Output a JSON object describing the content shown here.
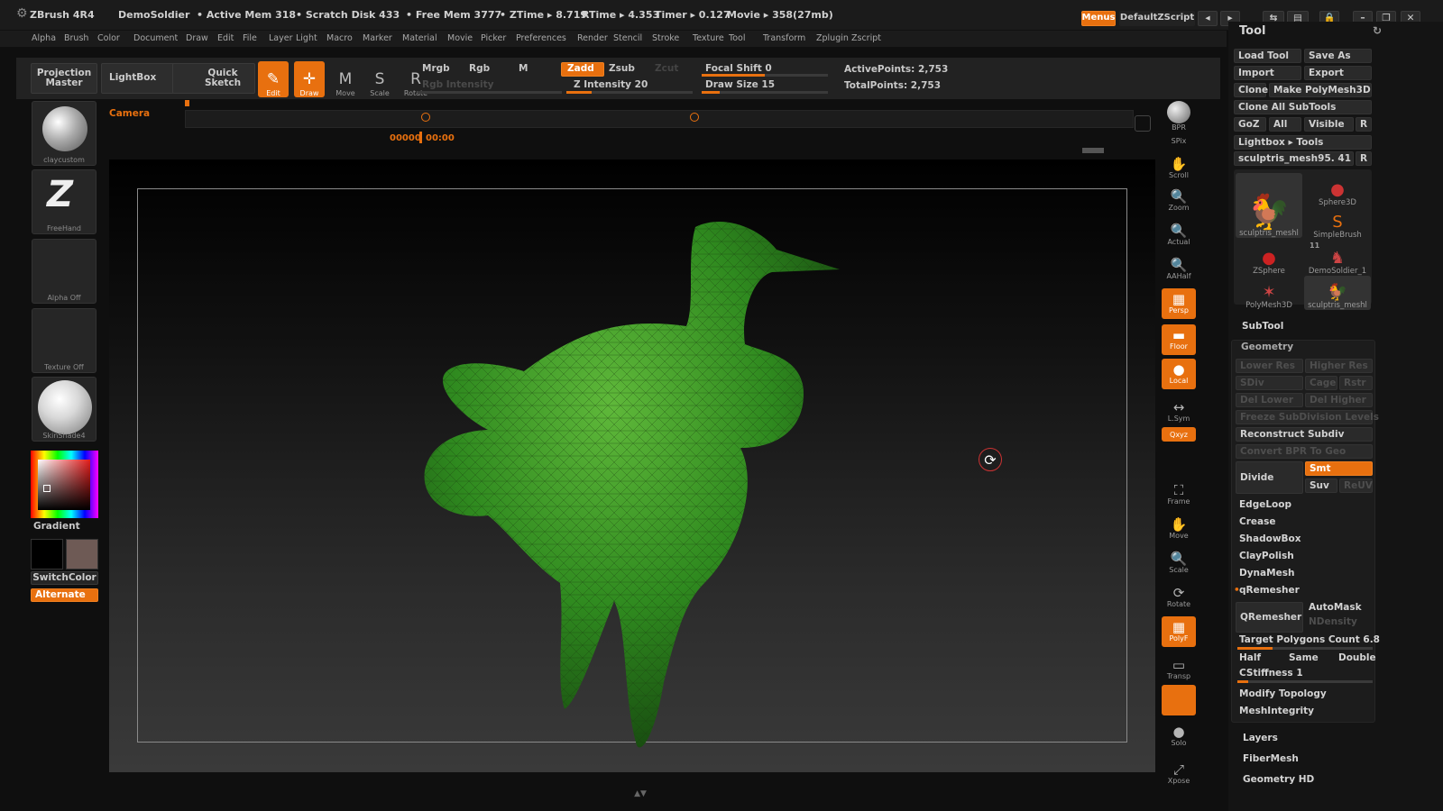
{
  "title": {
    "app": "ZBrush 4R4",
    "document": "DemoSoldier",
    "active_mem": "• Active Mem 318",
    "scratch_disk": "• Scratch Disk 433",
    "free_mem": "• Free Mem 3777",
    "ztime": "• ZTime ▸ 8.719",
    "rtime": "RTime ▸ 4.353",
    "timer": "Timer ▸ 0.127",
    "movie": "Movie ▸ 358(27mb)",
    "menus_btn": "Menus",
    "script_btn": "DefaultZScript"
  },
  "menu": [
    "Alpha",
    "Brush",
    "Color",
    "Document",
    "Draw",
    "Edit",
    "File",
    "Layer",
    "Light",
    "Macro",
    "Marker",
    "Material",
    "Movie",
    "Picker",
    "Preferences",
    "Render",
    "Stencil",
    "Stroke",
    "Texture",
    "Tool",
    "Transform",
    "Zplugin",
    "Zscript"
  ],
  "toolbar": {
    "projection_master": "Projection Master",
    "lightbox": "LightBox",
    "quick_sketch": "Quick Sketch",
    "edit": "Edit",
    "draw": "Draw",
    "move": "Move",
    "scale": "Scale",
    "rotate": "Rotate",
    "mrgb": "Mrgb",
    "rgb": "Rgb",
    "m": "M",
    "rgb_intensity": "Rgb Intensity",
    "zadd": "Zadd",
    "zsub": "Zsub",
    "zcut": "Zcut",
    "z_intensity": "Z Intensity 20",
    "z_intensity_value": 0.2,
    "focal_shift": "Focal Shift 0",
    "focal_shift_value": 0.5,
    "draw_size": "Draw Size 15",
    "draw_size_value": 0.14,
    "active_points": "ActivePoints: 2,753",
    "total_points": "TotalPoints: 2,753"
  },
  "timeline": {
    "track_label": "Camera",
    "time": "00000",
    "time2": "00:00"
  },
  "left": {
    "brush": "claycustom",
    "stroke": "FreeHand",
    "alpha": "Alpha Off",
    "texture": "Texture Off",
    "material": "SkinShade4",
    "gradient": "Gradient",
    "switch_color": "SwitchColor",
    "alternate": "Alternate"
  },
  "right_shelf": [
    {
      "name": "bpr-button",
      "icon": "sphere",
      "label": "BPR",
      "on": false
    },
    {
      "name": "spix-label",
      "icon": "",
      "label": "SPix",
      "on": false
    },
    {
      "name": "scroll-button",
      "icon": "✋",
      "label": "Scroll",
      "on": false
    },
    {
      "name": "zoom-button",
      "icon": "🔍",
      "label": "Zoom",
      "on": false
    },
    {
      "name": "actual-button",
      "icon": "🔍",
      "label": "Actual",
      "on": false
    },
    {
      "name": "aahalf-button",
      "icon": "🔍",
      "label": "AAHalf",
      "on": false
    },
    {
      "name": "persp-button",
      "icon": "▦",
      "label": "Persp",
      "on": true
    },
    {
      "name": "floor-button",
      "icon": "▬",
      "label": "Floor",
      "on": true
    },
    {
      "name": "local-button",
      "icon": "●",
      "label": "Local",
      "on": true
    },
    {
      "name": "lsym-button",
      "icon": "↔",
      "label": "L.Sym",
      "on": false
    },
    {
      "name": "xyz-button",
      "icon": "",
      "label": "Qxyz",
      "on": true
    },
    {
      "name": "frame-button",
      "icon": "⛶",
      "label": "Frame",
      "on": false
    },
    {
      "name": "move-view-button",
      "icon": "✋",
      "label": "Move",
      "on": false
    },
    {
      "name": "scale-view-button",
      "icon": "🔍",
      "label": "Scale",
      "on": false
    },
    {
      "name": "rotate-view-button",
      "icon": "⟳",
      "label": "Rotate",
      "on": false
    },
    {
      "name": "polyf-button",
      "icon": "▦",
      "label": "PolyF",
      "on": true
    },
    {
      "name": "transp-button",
      "icon": "▭",
      "label": "Transp",
      "on": false
    },
    {
      "name": "ghost-button",
      "icon": "",
      "label": "",
      "on": true
    },
    {
      "name": "solo-button",
      "icon": "●",
      "label": "Solo",
      "on": false
    },
    {
      "name": "xpose-button",
      "icon": "⤢",
      "label": "Xpose",
      "on": false
    }
  ],
  "tool": {
    "title": "Tool",
    "load_tool": "Load Tool",
    "save_as": "Save As",
    "import": "Import",
    "export": "Export",
    "clone": "Clone",
    "make_polymesh": "Make PolyMesh3D",
    "clone_all": "Clone All SubTools",
    "goz": "GoZ",
    "all": "All",
    "visible": "Visible",
    "r": "R",
    "lightbox_tools": "Lightbox ▸ Tools",
    "current_tool": "sculptris_mesh95. 41",
    "thumbs": [
      {
        "name": "sculptris-mesh-thumb",
        "label": "sculptris_meshl",
        "glyph": "🐓"
      },
      {
        "name": "sphere3d-thumb",
        "label": "Sphere3D",
        "glyph": "●"
      },
      {
        "name": "simplebrush-thumb",
        "label": "SimpleBrush",
        "glyph": "S"
      },
      {
        "name": "zsphere-thumb",
        "label": "ZSphere",
        "glyph": "●"
      },
      {
        "name": "demosoldier-thumb",
        "label": "DemoSoldier_1",
        "glyph": "♞"
      },
      {
        "name": "polymesh3d-thumb",
        "label": "PolyMesh3D",
        "glyph": "✶"
      },
      {
        "name": "sculptris-mesh2-thumb",
        "label": "sculptris_meshl",
        "glyph": "🐓"
      }
    ],
    "thumb_count": "11",
    "subtool": "SubTool",
    "geometry": "Geometry",
    "lower_res": "Lower Res",
    "higher_res": "Higher Res",
    "sdiv": "SDiv",
    "cage": "Cage",
    "rstr": "Rstr",
    "del_lower": "Del Lower",
    "del_higher": "Del Higher",
    "freeze": "Freeze SubDivision Levels",
    "reconstruct": "Reconstruct Subdiv",
    "convert_bpr": "Convert BPR To Geo",
    "divide": "Divide",
    "smt": "Smt",
    "suv": "Suv",
    "reuv": "ReUV",
    "edgeloop": "EdgeLoop",
    "crease": "Crease",
    "shadowbox": "ShadowBox",
    "claypolish": "ClayPolish",
    "dynamesh": "DynaMesh",
    "qremesher_head": "qRemesher",
    "qremesher_btn": "QRemesher",
    "automask": "AutoMask",
    "ndensity": "NDensity",
    "target_polys": "Target Polygons Count 6.8",
    "target_polys_value": 0.26,
    "half": "Half",
    "same": "Same",
    "double": "Double",
    "cstiffness": "CStiffness 1",
    "cstiffness_value": 0.08,
    "modify_topology": "Modify Topology",
    "mesh_integrity": "MeshIntegrity",
    "layers": "Layers",
    "fibermesh": "FiberMesh",
    "geometry_hd": "Geometry HD"
  }
}
